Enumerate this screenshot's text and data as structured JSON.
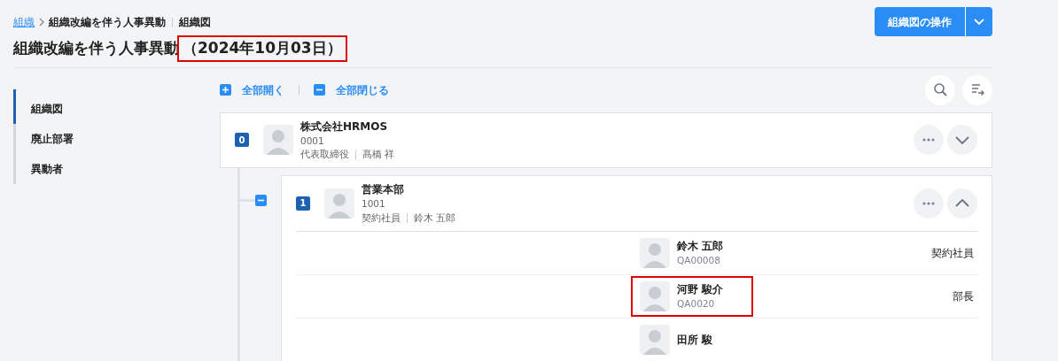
{
  "breadcrumb": [
    {
      "label": "組織",
      "link": true
    },
    {
      "label": "組織改編を伴う人事異動",
      "link": false
    },
    {
      "label": "組織図",
      "link": false
    }
  ],
  "title": {
    "name": "組織改編を伴う人事異動",
    "date": "（2024年10月03日）",
    "date_highlighted": true
  },
  "actions_button": {
    "label": "組織図の操作"
  },
  "sidebar": {
    "items": [
      {
        "label": "組織図",
        "selected": true
      },
      {
        "label": "廃止部署",
        "selected": false
      },
      {
        "label": "異動者",
        "selected": false
      }
    ]
  },
  "toolbar": {
    "expand_all": "全部開く",
    "collapse_all": "全部閉じる"
  },
  "root": {
    "level_badge": "0",
    "name": "株式会社HRMOS",
    "code": "0001",
    "role": "代表取締役",
    "head": "髙橋 祥",
    "expanded": false
  },
  "child": {
    "level_badge": "1",
    "name": "営業本部",
    "code": "1001",
    "role": "契約社員",
    "head": "鈴木 五郎",
    "expanded": true,
    "members": [
      {
        "name": "鈴木 五郎",
        "code": "QA00008",
        "position": "契約社員",
        "highlighted": false
      },
      {
        "name": "河野 駿介",
        "code": "QA0020",
        "position": "部長",
        "highlighted": true
      },
      {
        "name": "田所 駿",
        "highlighted": false
      }
    ]
  }
}
